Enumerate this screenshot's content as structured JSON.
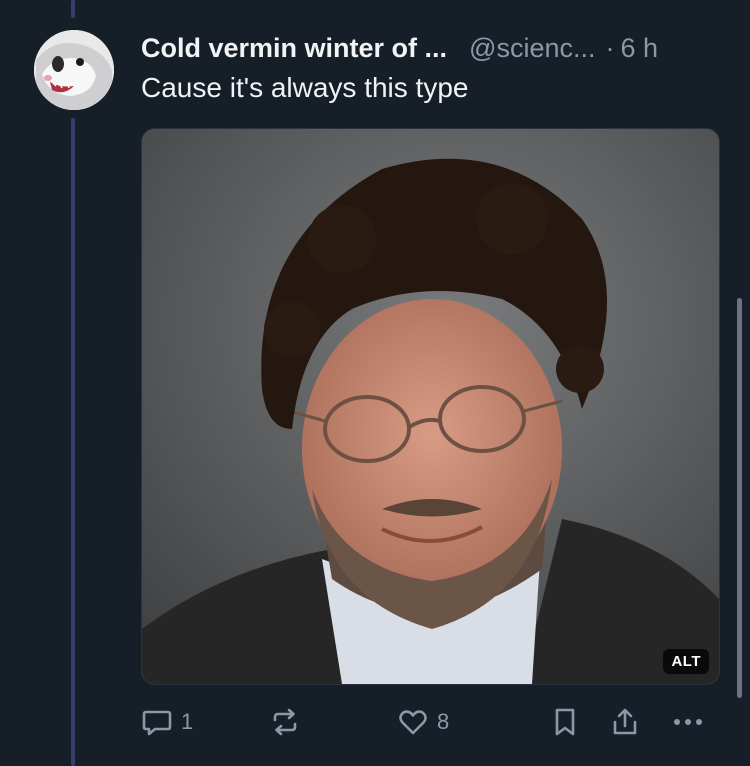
{
  "post": {
    "author_name": "Cold vermin winter of ...",
    "author_handle": "@scienc...",
    "separator": "·",
    "timestamp": "6 h",
    "text": "Cause it's always this type",
    "image_alt_badge": "ALT"
  },
  "actions": {
    "reply_count": "1",
    "like_count": "8"
  },
  "icons": {
    "reply": "speech-bubble-icon",
    "repost": "repost-arrows-icon",
    "like": "heart-icon",
    "bookmark": "bookmark-icon",
    "share": "share-icon",
    "more": "ellipsis-icon"
  },
  "colors": {
    "background": "#161e27",
    "thread_line": "#343f6e",
    "muted_text": "#8c98a6"
  }
}
